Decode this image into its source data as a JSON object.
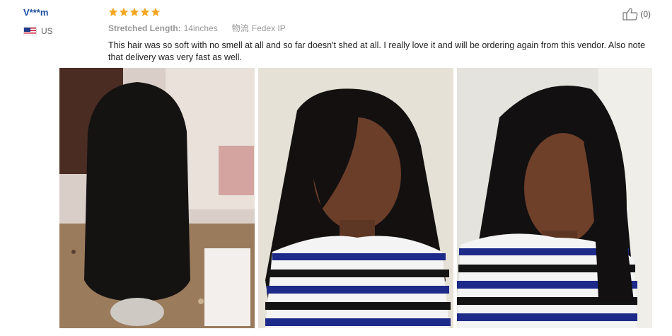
{
  "reviewer": {
    "name": "V***m",
    "country": "US"
  },
  "review": {
    "rating": 5,
    "rating_max": 5,
    "star_color": "#f5a623",
    "stretched_length_label": "Stretched Length:",
    "stretched_length_value": "14inches",
    "logistics_label": "物流",
    "logistics_value": "Fedex IP",
    "text": "This hair was so soft with no smell at all and so far doesn't shed at all. I really love it and will be ordering again from this vendor. Also note that delivery was very fast as well."
  },
  "helpful": {
    "count": "(0)",
    "icon": "thumbs-up-icon"
  },
  "photos": [
    {
      "icon": "photo-wig-on-mannequin"
    },
    {
      "icon": "photo-customer-front"
    },
    {
      "icon": "photo-customer-side"
    }
  ],
  "colors": {
    "name_link": "#1a4fa0",
    "meta_gray": "#999999",
    "text": "#222222"
  }
}
